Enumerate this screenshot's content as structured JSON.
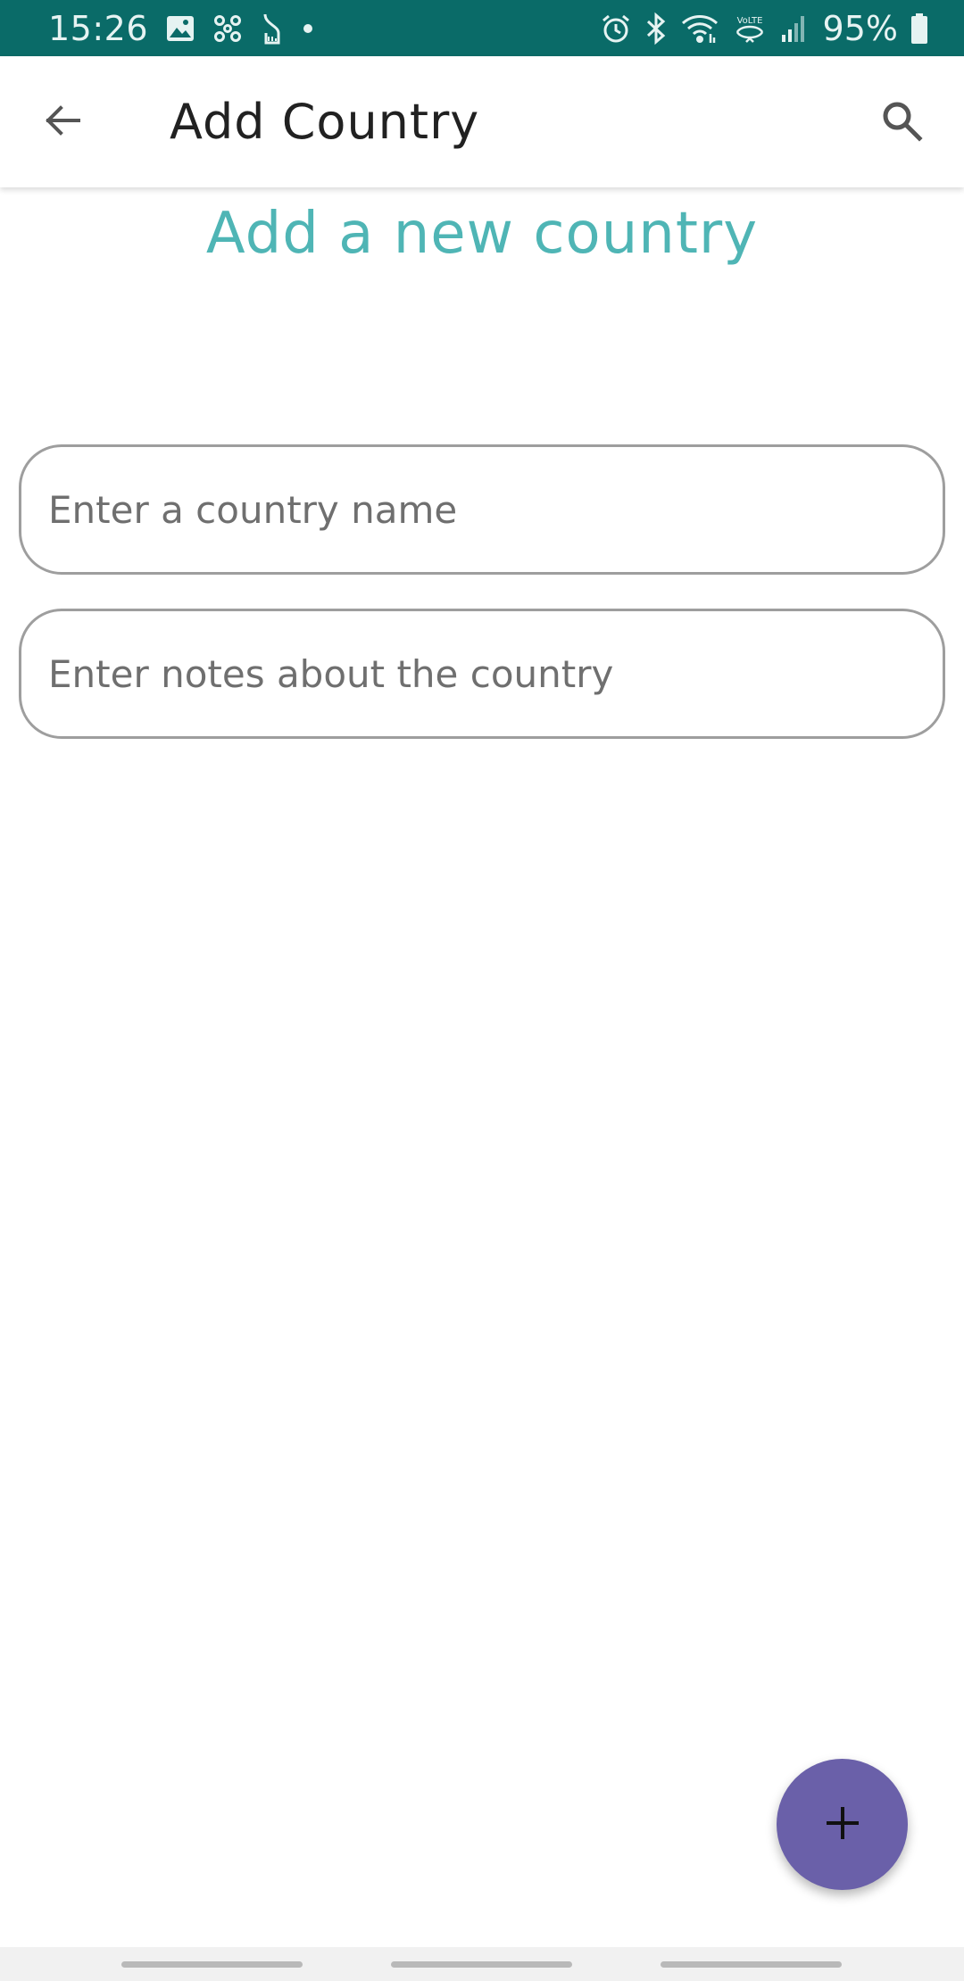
{
  "status_bar": {
    "time": "15:26",
    "battery_percent": "95%",
    "background_color": "#0a6b68",
    "left_icons": [
      "image-icon",
      "pinwheel-icon",
      "hourglass-icon",
      "dot-icon"
    ],
    "right_icons": [
      "alarm-icon",
      "bluetooth-icon",
      "wifi-icon",
      "volte-icon",
      "signal-icon",
      "battery-icon"
    ]
  },
  "app_bar": {
    "title": "Add Country",
    "back_icon": "arrow-back-icon",
    "search_icon": "search-icon"
  },
  "main": {
    "heading": "Add a new country",
    "heading_color": "#4fb5b5",
    "name_field": {
      "placeholder": "Enter a country name",
      "value": ""
    },
    "notes_field": {
      "placeholder": "Enter notes about the country",
      "value": ""
    }
  },
  "fab": {
    "icon": "plus-icon",
    "color": "#6a60a9"
  }
}
